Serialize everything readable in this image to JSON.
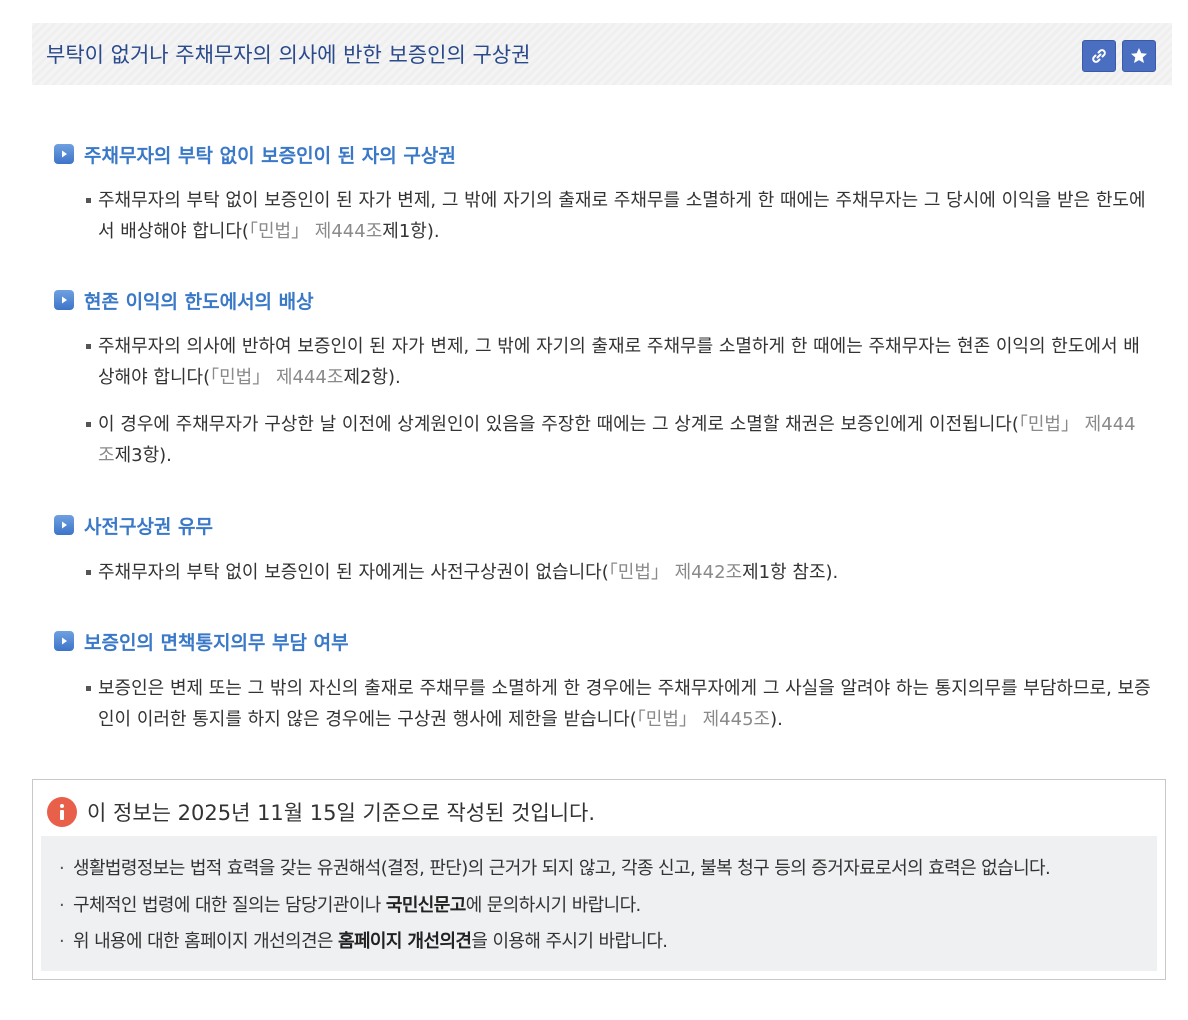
{
  "title": "부탁이 없거나 주채무자의 의사에 반한 보증인의 구상권",
  "sections": [
    {
      "heading": "주채무자의 부탁 없이 보증인이 된 자의 구상권",
      "items": [
        {
          "text": "주채무자의 부탁 없이 보증인이 된 자가 변제, 그 밖에 자기의 출재로 주채무를 소멸하게 한 때에는 주채무자는 그 당시에 이익을 받은 한도에서 배상해야 합니다(",
          "law": "「민법」 제444조",
          "tail": "제1항)."
        }
      ]
    },
    {
      "heading": "현존 이익의 한도에서의 배상",
      "items": [
        {
          "text": "주채무자의 의사에 반하여 보증인이 된 자가 변제, 그 밖에 자기의 출재로 주채무를 소멸하게 한 때에는 주채무자는 현존 이익의 한도에서 배상해야 합니다(",
          "law": "「민법」 제444조",
          "tail": "제2항)."
        },
        {
          "text": "이 경우에 주채무자가 구상한 날 이전에 상계원인이 있음을 주장한 때에는 그 상계로 소멸할 채권은 보증인에게 이전됩니다(",
          "law": "「민법」 제444조",
          "tail": "제3항)."
        }
      ]
    },
    {
      "heading": "사전구상권 유무",
      "items": [
        {
          "text": "주채무자의 부탁 없이 보증인이 된 자에게는 사전구상권이 없습니다(",
          "law": "「민법」 제442조",
          "tail": "제1항 참조)."
        }
      ]
    },
    {
      "heading": "보증인의 면책통지의무 부담 여부",
      "items": [
        {
          "text": "보증인은 변제 또는 그 밖의 자신의 출재로 주채무를 소멸하게 한 경우에는 주채무자에게 그 사실을 알려야 하는 통지의무를 부담하므로, 보증인이 이러한 통지를 하지 않은 경우에는 구상권 행사에 제한을 받습니다(",
          "law": "「민법」 제445조",
          "tail": ")."
        }
      ]
    }
  ],
  "notice": {
    "title": "이 정보는 2025년 11월 15일 기준으로 작성된 것입니다.",
    "line1": "생활법령정보는 법적 효력을 갖는 유권해석(결정, 판단)의 근거가 되지 않고, 각종 신고, 불복 청구 등의 증거자료로서의 효력은 없습니다.",
    "line2_pre": "구체적인 법령에 대한 질의는 담당기관이나 ",
    "line2_strong": "국민신문고",
    "line2_post": "에 문의하시기 바랍니다.",
    "line3_pre": "위 내용에 대한 홈페이지 개선의견은 ",
    "line3_strong": "홈페이지 개선의견",
    "line3_post": "을 이용해 주시기 바랍니다."
  },
  "icons": {
    "link": "link-icon",
    "bookmark": "star-icon",
    "section": "play-arrow-icon",
    "info": "info-icon"
  },
  "colors": {
    "title": "#2a4a8c",
    "heading": "#3a78c8",
    "law_reference": "#8a8a8a",
    "button": "#4a6fc0",
    "info_icon": "#e8604a"
  }
}
